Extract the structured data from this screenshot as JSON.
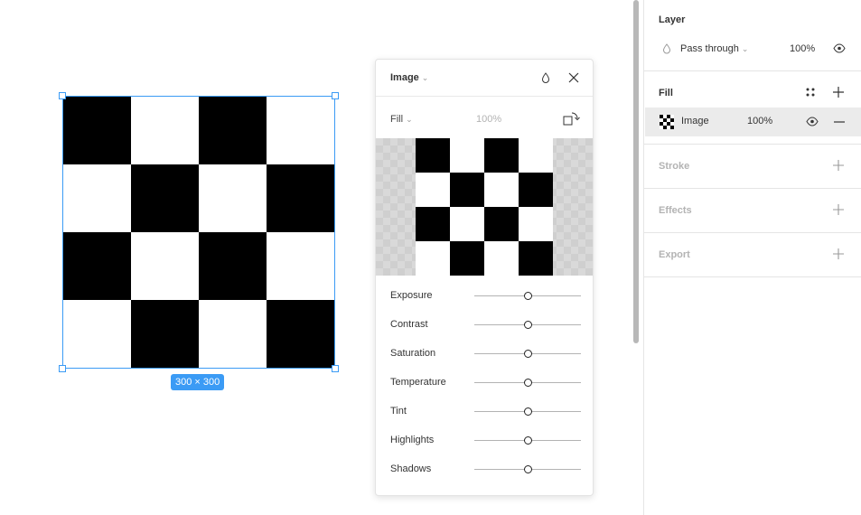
{
  "canvas": {
    "selection_size_label": "300 × 300",
    "board_pattern": [
      "bwbw",
      "wbwb",
      "bwbw",
      "wbwb"
    ]
  },
  "image_panel": {
    "title": "Image",
    "fill_mode": "Fill",
    "opacity": "100%",
    "adjustments": [
      {
        "label": "Exposure",
        "value": 0
      },
      {
        "label": "Contrast",
        "value": 0
      },
      {
        "label": "Saturation",
        "value": 0
      },
      {
        "label": "Temperature",
        "value": 0
      },
      {
        "label": "Tint",
        "value": 0
      },
      {
        "label": "Highlights",
        "value": 0
      },
      {
        "label": "Shadows",
        "value": 0
      }
    ]
  },
  "properties": {
    "layer": {
      "title": "Layer",
      "blend_mode": "Pass through",
      "opacity": "100%"
    },
    "fill": {
      "title": "Fill",
      "item_name": "Image",
      "item_opacity": "100%"
    },
    "stroke": {
      "title": "Stroke"
    },
    "effects": {
      "title": "Effects"
    },
    "export": {
      "title": "Export"
    }
  },
  "colors": {
    "selection_accent": "#3b9bf5",
    "checker_dark": "#000000",
    "checker_light": "#ffffff"
  }
}
